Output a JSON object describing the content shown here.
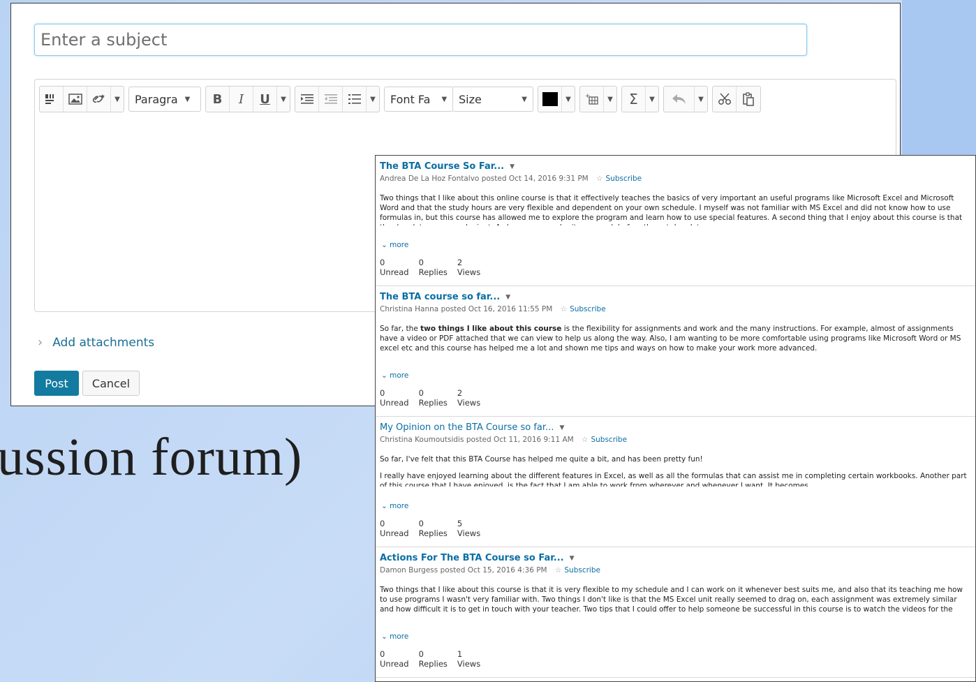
{
  "slide": {
    "title_fragment": "ussion forum)"
  },
  "editor": {
    "subject_placeholder": "Enter a subject",
    "toolbar": {
      "paragraph_label": "Paragra",
      "font_family_label": "Font Fa",
      "size_label": "Size"
    },
    "add_attachments_label": "Add attachments",
    "post_label": "Post",
    "cancel_label": "Cancel"
  },
  "threads": [
    {
      "title": "The BTA Course So Far...",
      "author": "Andrea De La Hoz Fontalvo",
      "posted": "posted Oct 14, 2016 9:31 PM",
      "subscribe": "Subscribe",
      "body": [
        "Two things that I like about this online course is that it effectively teaches the basics of very important an useful programs like Microsoft Excel and Microsoft Word and that the study hours are very flexible and dependent on your own schedule. I myself was not familiar with MS Excel and did not know how to use formulas in, but this course has allowed me to explore the program and learn how to use special features. A second thing that I enjoy about this course is that the due dates are very lenient. As long as you submit your work before the set due date, you can"
      ],
      "more": "more",
      "stats": {
        "unread": "0",
        "unread_label": "Unread",
        "replies": "0",
        "replies_label": "Replies",
        "views": "2",
        "views_label": "Views"
      }
    },
    {
      "title": "The BTA course so far...",
      "author": "Christina Hanna",
      "posted": "posted Oct 16, 2016 11:55 PM",
      "subscribe": "Subscribe",
      "body_pre": "So far, the ",
      "body_bold": "two things I like about this course",
      "body_post": " is the flexibility for assignments and work and the many instructions. For example, almost of assignments have a video or PDF attached that we can view to help us along the way. Also, I am wanting to be more comfortable using programs like Microsoft Word or MS excel etc and this course has helped me a lot and shown me tips and ways on how to make your work more advanced.",
      "more": "more",
      "stats": {
        "unread": "0",
        "unread_label": "Unread",
        "replies": "0",
        "replies_label": "Replies",
        "views": "2",
        "views_label": "Views"
      }
    },
    {
      "title": "My Opinion on the BTA Course so far...",
      "author": "Christina Koumoutsidis",
      "posted": "posted Oct 11, 2016 9:11 AM",
      "subscribe": "Subscribe",
      "body": [
        "So far, I've felt that this BTA Course has helped me quite a bit, and has been pretty fun!",
        "I really have enjoyed learning about the different features in Excel, as well as all the formulas that can assist me in completing certain workbooks. Another part of this course that I have enjoyed, is the fact that I am able to work from wherever and whenever I want. It becomes"
      ],
      "more": "more",
      "stats": {
        "unread": "0",
        "unread_label": "Unread",
        "replies": "0",
        "replies_label": "Replies",
        "views": "5",
        "views_label": "Views"
      }
    },
    {
      "title": "Actions For The BTA Course so Far...",
      "author": "Damon Burgess",
      "posted": "posted Oct 15, 2016 4:36 PM",
      "subscribe": "Subscribe",
      "body": [
        "Two things that I like about this course is that it is very flexible to my schedule and I can work on it whenever best suits me, and also that its teaching me how to use programs I wasn't very familiar with. Two things I don't like is that the MS Excel unit really seemed to drag on, each assignment was extremely similar and how difficult it is to get in touch with your teacher. Two tips that I could offer to help someone be successful in this course is to watch the videos for the assignments and take them step by step, and also not to save all your weeks worth of work for one"
      ],
      "more": "more",
      "stats": {
        "unread": "0",
        "unread_label": "Unread",
        "replies": "0",
        "replies_label": "Replies",
        "views": "1",
        "views_label": "Views"
      }
    }
  ]
}
